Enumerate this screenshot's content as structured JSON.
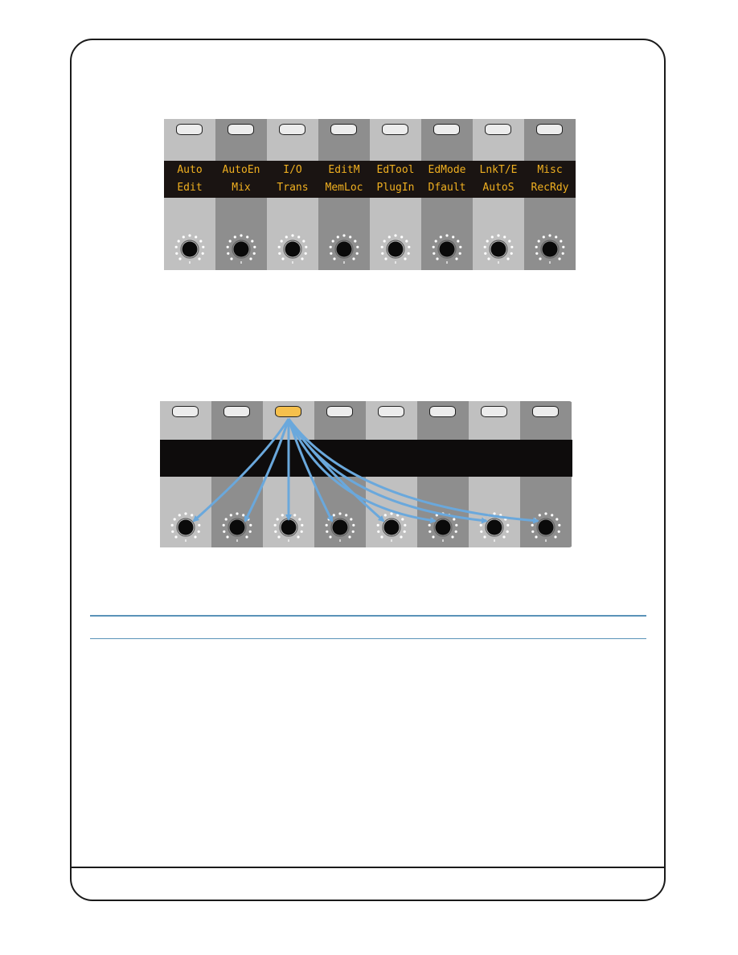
{
  "diagram1": {
    "name": "soft-key-display-panel",
    "columns": [
      {
        "shade": "light",
        "top": "Auto",
        "bottom": "Edit"
      },
      {
        "shade": "dark",
        "top": "AutoEn",
        "bottom": "Mix"
      },
      {
        "shade": "light",
        "top": "I/O",
        "bottom": "Trans"
      },
      {
        "shade": "dark",
        "top": "EditM",
        "bottom": "MemLoc"
      },
      {
        "shade": "light",
        "top": "EdTool",
        "bottom": "PlugIn"
      },
      {
        "shade": "dark",
        "top": "EdMode",
        "bottom": "Dfault"
      },
      {
        "shade": "light",
        "top": "LnkT/E",
        "bottom": "AutoS"
      },
      {
        "shade": "dark",
        "top": "Misc",
        "bottom": "RecRdy"
      }
    ]
  },
  "diagram2": {
    "name": "active-key-mapping-panel",
    "active_button_index": 2,
    "columns": [
      {
        "shade": "light"
      },
      {
        "shade": "dark"
      },
      {
        "shade": "light"
      },
      {
        "shade": "dark"
      },
      {
        "shade": "light"
      },
      {
        "shade": "dark"
      },
      {
        "shade": "light"
      },
      {
        "shade": "dark"
      }
    ],
    "arrow_targets": [
      0,
      1,
      2,
      3,
      4,
      5,
      6,
      7
    ]
  },
  "colors": {
    "lcd_text": "#f0b020",
    "active_button": "#f6c04c",
    "arrow": "#6aa8dc",
    "rule": "#5a93b8",
    "col_light": "#c0c0c0",
    "col_dark": "#8e8e8e"
  }
}
